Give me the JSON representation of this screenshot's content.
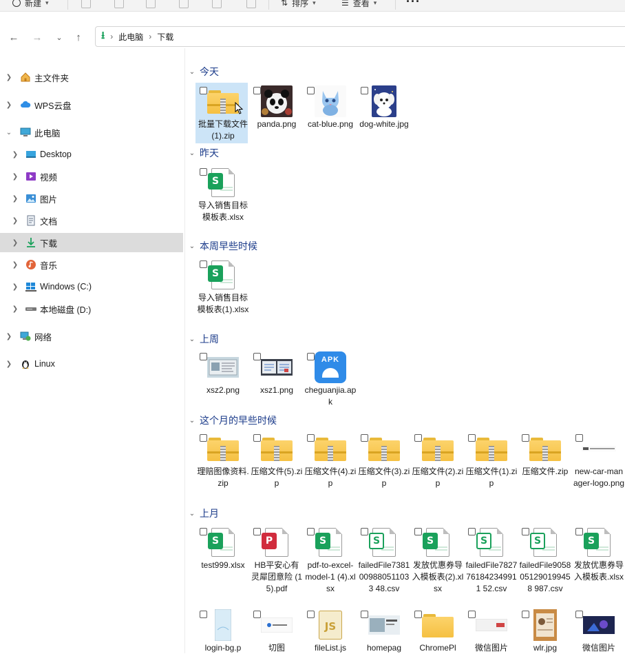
{
  "toolbar": {
    "new_label": "新建",
    "sort_label": "排序",
    "view_label": "查看"
  },
  "address": {
    "segments": [
      "此电脑",
      "下载"
    ]
  },
  "sidebar": {
    "items": [
      {
        "label": "主文件夹"
      },
      {
        "label": "WPS云盘"
      },
      {
        "label": "此电脑"
      },
      {
        "label": "Desktop"
      },
      {
        "label": "视频"
      },
      {
        "label": "图片"
      },
      {
        "label": "文档"
      },
      {
        "label": "下载"
      },
      {
        "label": "音乐"
      },
      {
        "label": "Windows (C:)"
      },
      {
        "label": "本地磁盘 (D:)"
      },
      {
        "label": "网络"
      },
      {
        "label": "Linux"
      }
    ]
  },
  "groups": [
    {
      "title": "今天",
      "files": [
        "批量下载文件 (1).zip",
        "panda.png",
        "cat-blue.png",
        "dog-white.jpg"
      ]
    },
    {
      "title": "昨天",
      "files": [
        "导入销售目标模板表.xlsx"
      ]
    },
    {
      "title": "本周早些时候",
      "files": [
        "导入销售目标模板表(1).xlsx"
      ]
    },
    {
      "title": "上周",
      "files": [
        "xsz2.png",
        "xsz1.png",
        "cheguanjia.apk"
      ]
    },
    {
      "title": "这个月的早些时候",
      "files": [
        "理赔图像资料.zip",
        "压缩文件(5).zip",
        "压缩文件(4).zip",
        "压缩文件(3).zip",
        "压缩文件(2).zip",
        "压缩文件(1).zip",
        "压缩文件.zip",
        "new-car-manager-logo.png"
      ]
    },
    {
      "title": "上月",
      "files": [
        "test999.xlsx",
        "HB平安心有灵犀团意险 (15).pdf",
        "pdf-to-excel-model-1 (4).xlsx",
        "failedFile7381009880511033 48.csv",
        "发放优惠券导入模板表(2).xlsx",
        "failedFile7827761842349911 52.csv",
        "failedFile9058051290199458 987.csv",
        "发放优惠券导入模板表.xlsx"
      ]
    },
    {
      "title": "",
      "files": [
        "login-bg.p",
        "切图",
        "fileList.js",
        "homepag",
        "ChromePl",
        "微信图片",
        "wlr.jpg",
        "微信图片"
      ]
    }
  ],
  "icons": {
    "apk_badge": "APK"
  }
}
